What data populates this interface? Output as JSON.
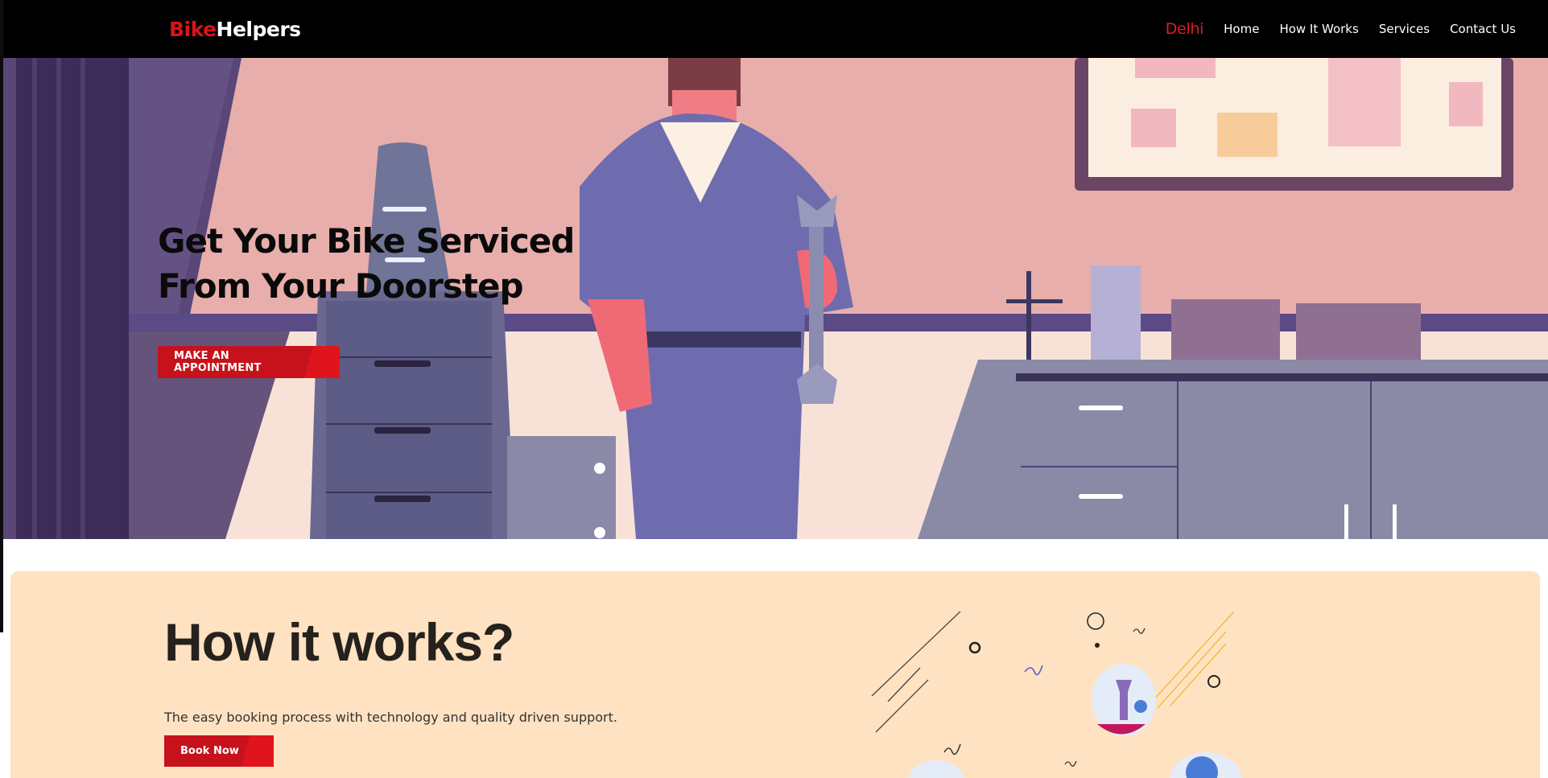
{
  "header": {
    "logo": {
      "part1": "Bike",
      "part2": "Helpers"
    },
    "city": "Delhi",
    "nav": [
      "Home",
      "How It Works",
      "Services",
      "Contact Us"
    ]
  },
  "hero": {
    "title_line1": "Get Your Bike Serviced",
    "title_line2": "From Your Doorstep",
    "cta_label": "MAKE AN APPOINTMENT",
    "image": "mechanic-holding-wrench-in-workshop"
  },
  "how_it_works": {
    "title": "How it works?",
    "description": "The easy booking process with technology and quality driven support.",
    "button_label": "Book Now",
    "illustration": "floating-tools-decoration"
  },
  "colors": {
    "brand_red": "#d7131a",
    "button_red": "#c7121b",
    "header_bg": "#000000",
    "section_bg": "#fee2c2"
  },
  "icons": {
    "cta_arrow": "arrow-right-icon",
    "book_arrow": "arrow-right-icon"
  }
}
